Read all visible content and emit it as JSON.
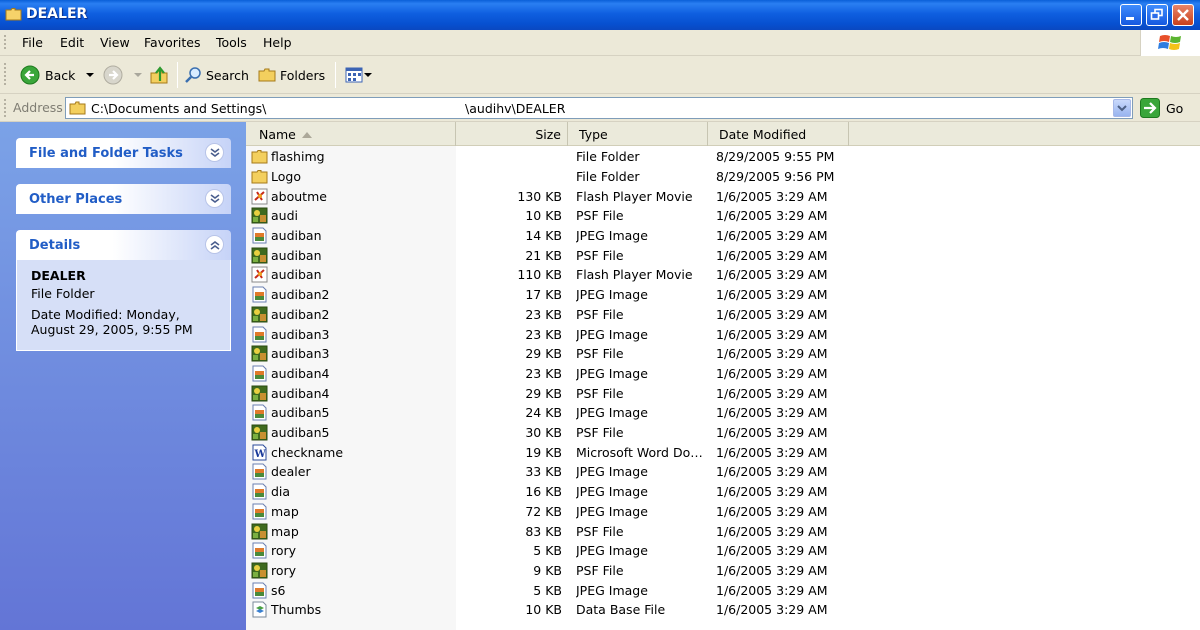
{
  "window": {
    "title": "DEALER"
  },
  "menu": [
    "File",
    "Edit",
    "View",
    "Favorites",
    "Tools",
    "Help"
  ],
  "toolbar": {
    "back": "Back",
    "search": "Search",
    "folders": "Folders"
  },
  "address": {
    "label": "Address",
    "path": "C:\\Documents and Settings\\                                                  \\audihv\\DEALER",
    "go": "Go"
  },
  "left_pane": {
    "file_tasks": "File and Folder Tasks",
    "other_places": "Other Places",
    "details": {
      "heading": "Details",
      "name": "DEALER",
      "kind": "File Folder",
      "modified": "Date Modified: Monday, August 29, 2005, 9:55 PM"
    }
  },
  "columns": {
    "name": "Name",
    "size": "Size",
    "type": "Type",
    "date": "Date Modified"
  },
  "files": [
    {
      "name": "flashimg",
      "size": "",
      "type": "File Folder",
      "date": "8/29/2005 9:55 PM",
      "icon": "folder"
    },
    {
      "name": "Logo",
      "size": "",
      "type": "File Folder",
      "date": "8/29/2005 9:56 PM",
      "icon": "folder"
    },
    {
      "name": "aboutme",
      "size": "130 KB",
      "type": "Flash Player Movie",
      "date": "1/6/2005 3:29 AM",
      "icon": "flash"
    },
    {
      "name": "audi",
      "size": "10 KB",
      "type": "PSF File",
      "date": "1/6/2005 3:29 AM",
      "icon": "psf"
    },
    {
      "name": "audiban",
      "size": "14 KB",
      "type": "JPEG Image",
      "date": "1/6/2005 3:29 AM",
      "icon": "jpeg"
    },
    {
      "name": "audiban",
      "size": "21 KB",
      "type": "PSF File",
      "date": "1/6/2005 3:29 AM",
      "icon": "psf"
    },
    {
      "name": "audiban",
      "size": "110 KB",
      "type": "Flash Player Movie",
      "date": "1/6/2005 3:29 AM",
      "icon": "flash"
    },
    {
      "name": "audiban2",
      "size": "17 KB",
      "type": "JPEG Image",
      "date": "1/6/2005 3:29 AM",
      "icon": "jpeg"
    },
    {
      "name": "audiban2",
      "size": "23 KB",
      "type": "PSF File",
      "date": "1/6/2005 3:29 AM",
      "icon": "psf"
    },
    {
      "name": "audiban3",
      "size": "23 KB",
      "type": "JPEG Image",
      "date": "1/6/2005 3:29 AM",
      "icon": "jpeg"
    },
    {
      "name": "audiban3",
      "size": "29 KB",
      "type": "PSF File",
      "date": "1/6/2005 3:29 AM",
      "icon": "psf"
    },
    {
      "name": "audiban4",
      "size": "23 KB",
      "type": "JPEG Image",
      "date": "1/6/2005 3:29 AM",
      "icon": "jpeg"
    },
    {
      "name": "audiban4",
      "size": "29 KB",
      "type": "PSF File",
      "date": "1/6/2005 3:29 AM",
      "icon": "psf"
    },
    {
      "name": "audiban5",
      "size": "24 KB",
      "type": "JPEG Image",
      "date": "1/6/2005 3:29 AM",
      "icon": "jpeg"
    },
    {
      "name": "audiban5",
      "size": "30 KB",
      "type": "PSF File",
      "date": "1/6/2005 3:29 AM",
      "icon": "psf"
    },
    {
      "name": "checkname",
      "size": "19 KB",
      "type": "Microsoft Word Doc...",
      "date": "1/6/2005 3:29 AM",
      "icon": "word"
    },
    {
      "name": "dealer",
      "size": "33 KB",
      "type": "JPEG Image",
      "date": "1/6/2005 3:29 AM",
      "icon": "jpeg"
    },
    {
      "name": "dia",
      "size": "16 KB",
      "type": "JPEG Image",
      "date": "1/6/2005 3:29 AM",
      "icon": "jpeg"
    },
    {
      "name": "map",
      "size": "72 KB",
      "type": "JPEG Image",
      "date": "1/6/2005 3:29 AM",
      "icon": "jpeg"
    },
    {
      "name": "map",
      "size": "83 KB",
      "type": "PSF File",
      "date": "1/6/2005 3:29 AM",
      "icon": "psf"
    },
    {
      "name": "rory",
      "size": "5 KB",
      "type": "JPEG Image",
      "date": "1/6/2005 3:29 AM",
      "icon": "jpeg"
    },
    {
      "name": "rory",
      "size": "9 KB",
      "type": "PSF File",
      "date": "1/6/2005 3:29 AM",
      "icon": "psf"
    },
    {
      "name": "s6",
      "size": "5 KB",
      "type": "JPEG Image",
      "date": "1/6/2005 3:29 AM",
      "icon": "jpeg"
    },
    {
      "name": "Thumbs",
      "size": "10 KB",
      "type": "Data Base File",
      "date": "1/6/2005 3:29 AM",
      "icon": "db"
    }
  ]
}
